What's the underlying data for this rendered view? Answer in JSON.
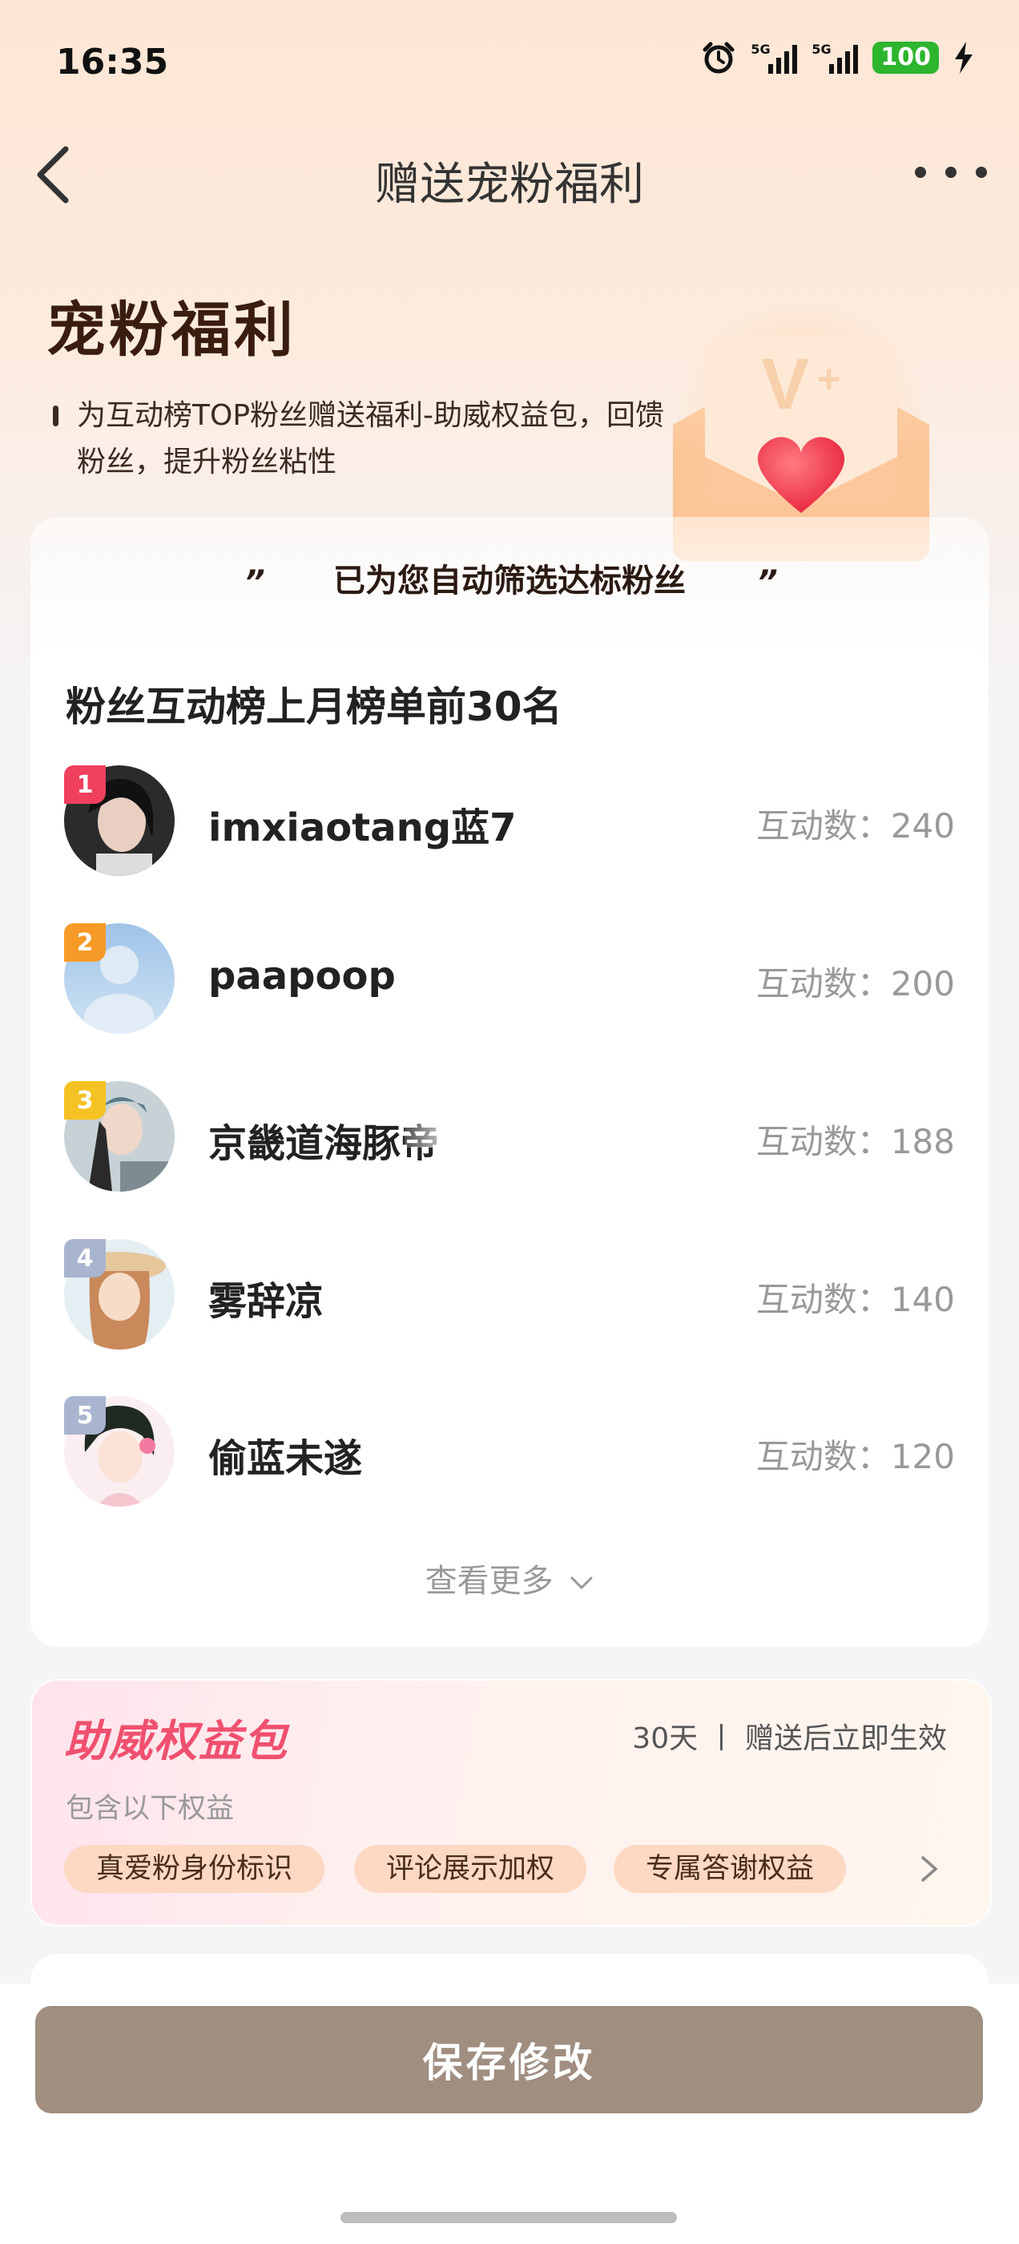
{
  "status_bar": {
    "time": "16:35",
    "signal_1_tag": "5G",
    "signal_2_tag": "5G",
    "battery": "100"
  },
  "nav": {
    "title": "赠送宠粉福利"
  },
  "hero": {
    "title": "宠粉福利",
    "description": "为互动榜TOP粉丝赠送福利-助威权益包，回馈粉丝，提升粉丝粘性"
  },
  "filter": {
    "text": "已为您自动筛选达标粉丝",
    "quote_left": "”",
    "quote_right": "”"
  },
  "fan_list": {
    "title": "粉丝互动榜上月榜单前30名",
    "count_label": "互动数：",
    "items": [
      {
        "rank": "1",
        "name": "imxiaotang蓝7",
        "count": "240",
        "rank_color": "#f0405e"
      },
      {
        "rank": "2",
        "name": "paapoop",
        "count": "200",
        "rank_color": "#f79a28"
      },
      {
        "rank": "3",
        "name": "京畿道海豚帝",
        "count": "188",
        "rank_color": "#f5c223"
      },
      {
        "rank": "4",
        "name": "雾辞凉",
        "count": "140",
        "rank_color": "#a9b4cf"
      },
      {
        "rank": "5",
        "name": "偷蓝未遂",
        "count": "120",
        "rank_color": "#a9b4cf"
      }
    ],
    "see_more": "查看更多"
  },
  "package": {
    "title": "助威权益包",
    "meta": "30天 丨 赠送后立即生效",
    "subtitle": "包含以下权益",
    "chips": [
      "真爱粉身份标识",
      "评论展示加权",
      "专属答谢权益"
    ]
  },
  "footer": {
    "save_label": "保存修改"
  },
  "colors": {
    "accent_pink": "#f0506f",
    "save_button": "#a08e81"
  }
}
